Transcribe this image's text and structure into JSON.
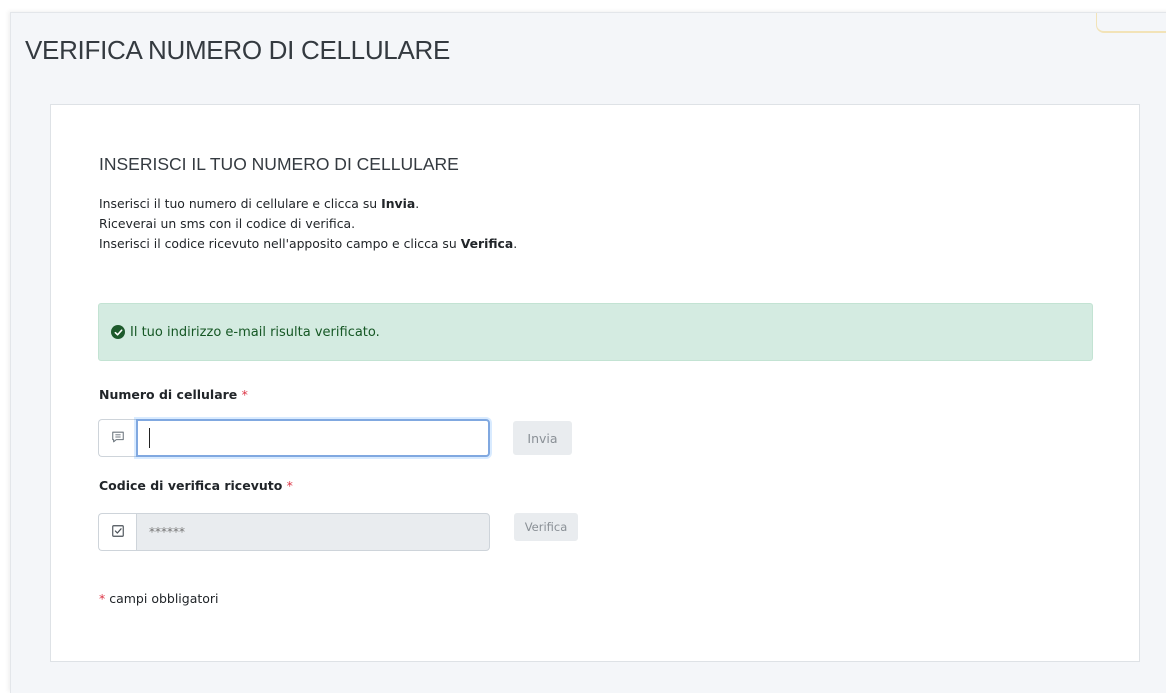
{
  "page": {
    "title": "VERIFICA NUMERO DI CELLULARE"
  },
  "card": {
    "section_title": "INSERISCI IL TUO NUMERO DI CELLULARE",
    "instructions": {
      "line1_prefix": "Inserisci il tuo numero di cellulare e clicca su ",
      "line1_bold": "Invia",
      "line1_suffix": ".",
      "line2": "Riceverai un sms con il codice di verifica.",
      "line3_prefix": "Inserisci il codice ricevuto nell'apposito campo e clicca su ",
      "line3_bold": "Verifica",
      "line3_suffix": "."
    },
    "alert": {
      "message": "Il tuo indirizzo e-mail risulta verificato.",
      "icon": "check-circle-icon",
      "background": "#d4ebe1"
    },
    "phone_field": {
      "label": "Numero di cellulare",
      "required_mark": "*",
      "value": "",
      "icon": "message-icon",
      "button_label": "Invia"
    },
    "code_field": {
      "label": "Codice di verifica ricevuto",
      "required_mark": "*",
      "placeholder": "******",
      "icon": "check-square-icon",
      "button_label": "Verifica"
    },
    "required_note": {
      "mark": "*",
      "text": " campi obbligatori"
    }
  },
  "colors": {
    "required": "#dc3545",
    "focus_border": "#80a8e0"
  }
}
